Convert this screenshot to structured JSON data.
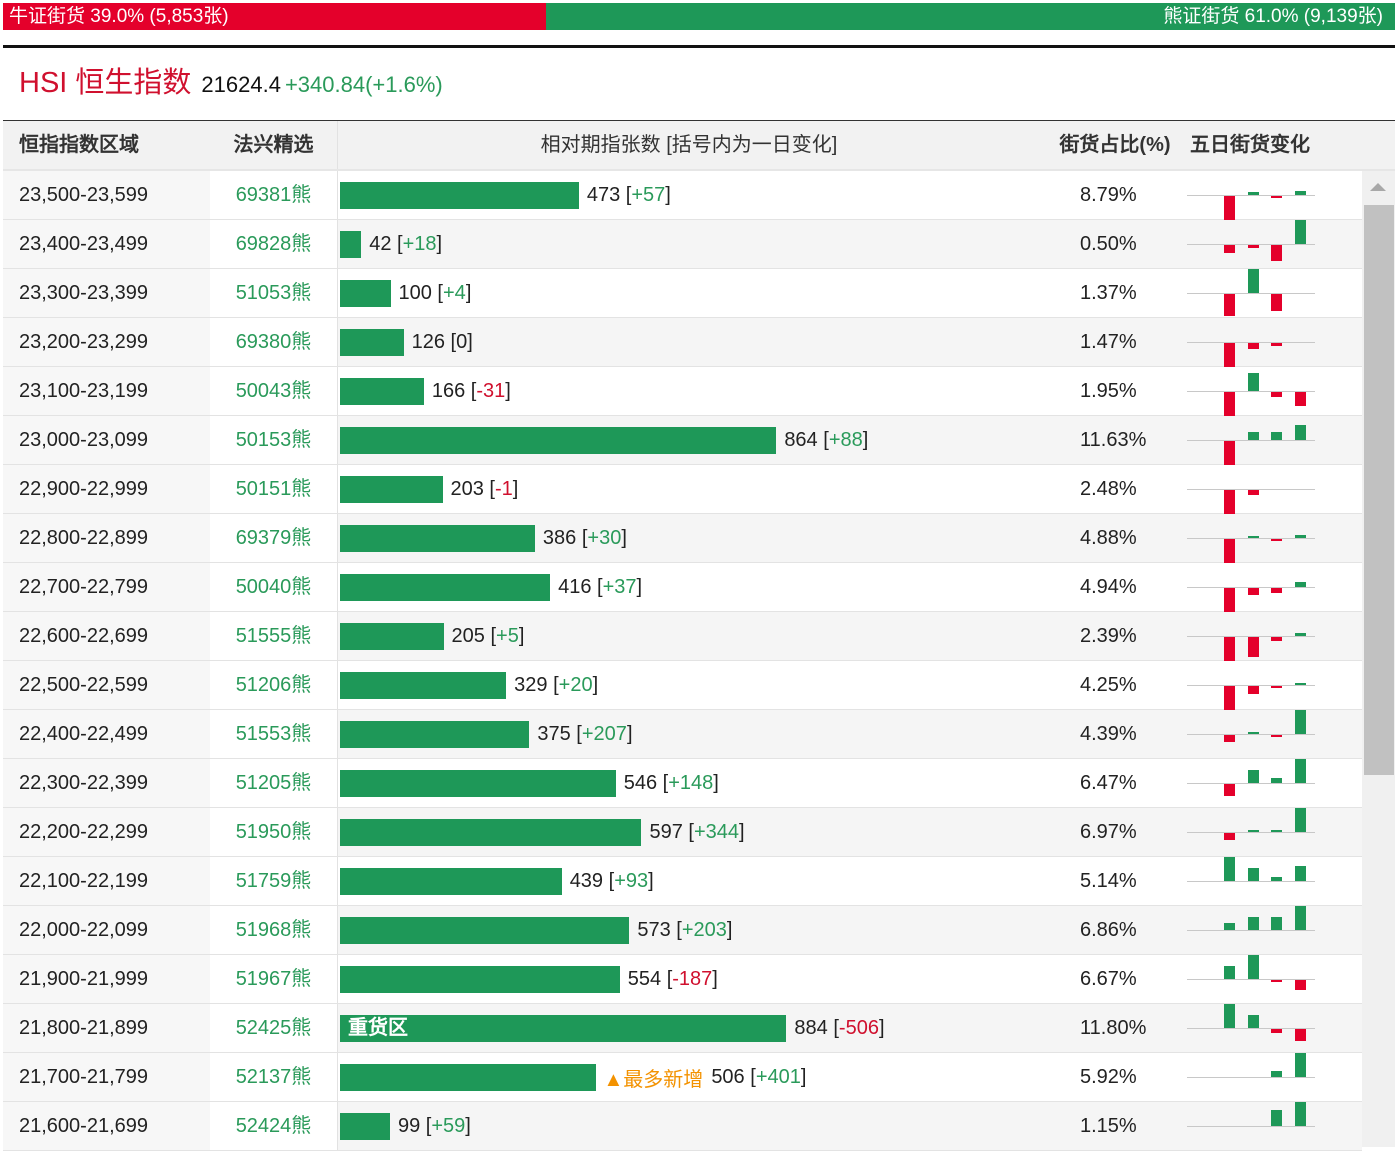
{
  "ratio": {
    "bull_label": "牛证街货 39.0% (5,853张)",
    "bull_pct": 39.0,
    "bear_label": "熊证街货 61.0% (9,139张)",
    "bear_pct": 61.0
  },
  "index": {
    "name": "HSI 恒生指数",
    "price": "21624.4",
    "change": "+340.84(+1.6%)"
  },
  "headers": [
    "恒指指数区域",
    "法兴精选",
    "相对期指张数 [括号内为一日变化]",
    "街货占比(%)",
    "五日街货变化"
  ],
  "colors": {
    "red": "#e4002b",
    "green": "#1e9858"
  },
  "rows": [
    {
      "range": "23,500-23,599",
      "code": "69381熊",
      "count": 473,
      "count_label": "473",
      "change": "+57",
      "pct": "8.79%",
      "five": [
        -24,
        3,
        -2,
        4
      ]
    },
    {
      "range": "23,400-23,499",
      "code": "69828熊",
      "count": 42,
      "count_label": "42",
      "change": "+18",
      "pct": "0.50%",
      "five": [
        -8,
        -3,
        -16,
        24
      ]
    },
    {
      "range": "23,300-23,399",
      "code": "51053熊",
      "count": 100,
      "count_label": "100",
      "change": "+4",
      "pct": "1.37%",
      "five": [
        -22,
        24,
        -17,
        0
      ]
    },
    {
      "range": "23,200-23,299",
      "code": "69380熊",
      "count": 126,
      "count_label": "126",
      "change": "0",
      "pct": "1.47%",
      "five": [
        -24,
        -6,
        -3,
        0
      ]
    },
    {
      "range": "23,100-23,199",
      "code": "50043熊",
      "count": 166,
      "count_label": "166",
      "change": "-31",
      "pct": "1.95%",
      "five": [
        -24,
        18,
        -5,
        -14
      ]
    },
    {
      "range": "23,000-23,099",
      "code": "50153熊",
      "count": 864,
      "count_label": "864",
      "change": "+88",
      "pct": "11.63%",
      "five": [
        -24,
        8,
        8,
        15
      ]
    },
    {
      "range": "22,900-22,999",
      "code": "50151熊",
      "count": 203,
      "count_label": "203",
      "change": "-1",
      "pct": "2.48%",
      "five": [
        -24,
        -5,
        0,
        0
      ]
    },
    {
      "range": "22,800-22,899",
      "code": "69379熊",
      "count": 386,
      "count_label": "386",
      "change": "+30",
      "pct": "4.88%",
      "five": [
        -24,
        2,
        -2,
        3
      ]
    },
    {
      "range": "22,700-22,799",
      "code": "50040熊",
      "count": 416,
      "count_label": "416",
      "change": "+37",
      "pct": "4.94%",
      "five": [
        -24,
        -7,
        -5,
        5
      ]
    },
    {
      "range": "22,600-22,699",
      "code": "51555熊",
      "count": 205,
      "count_label": "205",
      "change": "+5",
      "pct": "2.39%",
      "five": [
        -24,
        -20,
        -4,
        3
      ]
    },
    {
      "range": "22,500-22,599",
      "code": "51206熊",
      "count": 329,
      "count_label": "329",
      "change": "+20",
      "pct": "4.25%",
      "five": [
        -24,
        -8,
        -2,
        2
      ]
    },
    {
      "range": "22,400-22,499",
      "code": "51553熊",
      "count": 375,
      "count_label": "375",
      "change": "+207",
      "pct": "4.39%",
      "five": [
        -7,
        2,
        -2,
        24
      ]
    },
    {
      "range": "22,300-22,399",
      "code": "51205熊",
      "count": 546,
      "count_label": "546",
      "change": "+148",
      "pct": "6.47%",
      "five": [
        -12,
        13,
        5,
        24
      ]
    },
    {
      "range": "22,200-22,299",
      "code": "51950熊",
      "count": 597,
      "count_label": "597",
      "change": "+344",
      "pct": "6.97%",
      "five": [
        -7,
        2,
        2,
        24
      ]
    },
    {
      "range": "22,100-22,199",
      "code": "51759熊",
      "count": 439,
      "count_label": "439",
      "change": "+93",
      "pct": "5.14%",
      "five": [
        24,
        13,
        4,
        15
      ]
    },
    {
      "range": "22,000-22,099",
      "code": "51968熊",
      "count": 573,
      "count_label": "573",
      "change": "+203",
      "pct": "6.86%",
      "five": [
        7,
        13,
        13,
        24
      ]
    },
    {
      "range": "21,900-21,999",
      "code": "51967熊",
      "count": 554,
      "count_label": "554",
      "change": "-187",
      "pct": "6.67%",
      "five": [
        13,
        24,
        -2,
        -10
      ]
    },
    {
      "range": "21,800-21,899",
      "code": "52425熊",
      "count": 884,
      "count_label": "884",
      "change": "-506",
      "pct": "11.80%",
      "bar_label": "重货区",
      "five": [
        24,
        13,
        -4,
        -12
      ]
    },
    {
      "range": "21,700-21,799",
      "code": "52137熊",
      "count": 506,
      "count_label": "506",
      "change": "+401",
      "pct": "5.92%",
      "tag": "▲最多新增",
      "five": [
        0,
        0,
        6,
        24
      ]
    },
    {
      "range": "21,600-21,699",
      "code": "52424熊",
      "count": 99,
      "count_label": "99",
      "change": "+59",
      "pct": "1.15%",
      "five": [
        0,
        0,
        16,
        24
      ]
    }
  ]
}
